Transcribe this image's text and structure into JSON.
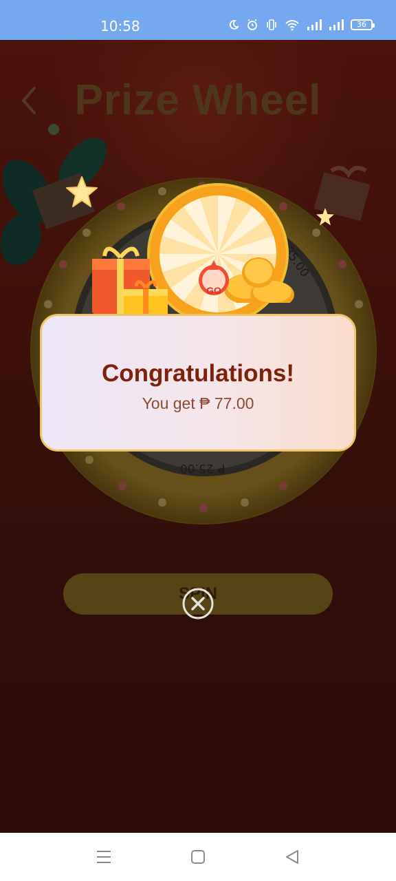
{
  "status_bar": {
    "time": "10:58",
    "battery": "36",
    "icons": [
      "moon-icon",
      "alarm-icon",
      "vibrate-icon",
      "wifi-icon",
      "signal-icon",
      "signal-icon",
      "battery-icon"
    ]
  },
  "header": {
    "title": "Prize Wheel",
    "back_icon": "chevron-left-icon"
  },
  "wheel": {
    "prizes_visible": [
      "₱ 35.00",
      "₱ 25.00"
    ],
    "go_label": "GO"
  },
  "spin_button": {
    "label": "SPIN"
  },
  "dialog": {
    "title": "Congratulations!",
    "message": "You get ₱ 77.00"
  },
  "close_icon": "close-circle-icon",
  "nav_bar": {
    "icons": [
      "menu-icon",
      "home-square-icon",
      "back-triangle-icon"
    ]
  },
  "colors": {
    "status_bar": "#74a9f0",
    "dialog_title": "#7d200c",
    "dialog_border": "#f0c469",
    "backdrop": "#300d08"
  }
}
